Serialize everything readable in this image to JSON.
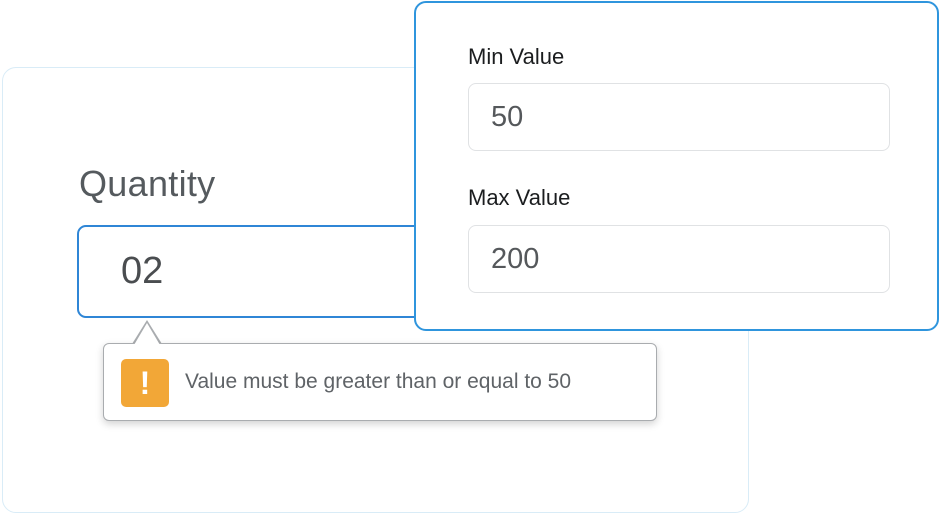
{
  "quantity": {
    "label": "Quantity",
    "value": "02"
  },
  "validation": {
    "icon": "warning-icon",
    "icon_glyph": "!",
    "message": "Value must be greater than or equal to 50",
    "icon_color": "#f2a737"
  },
  "config_panel": {
    "min_label": "Min Value",
    "min_value": "50",
    "max_label": "Max Value",
    "max_value": "200"
  },
  "colors": {
    "accent": "#2f86d6",
    "warning": "#f2a737"
  }
}
